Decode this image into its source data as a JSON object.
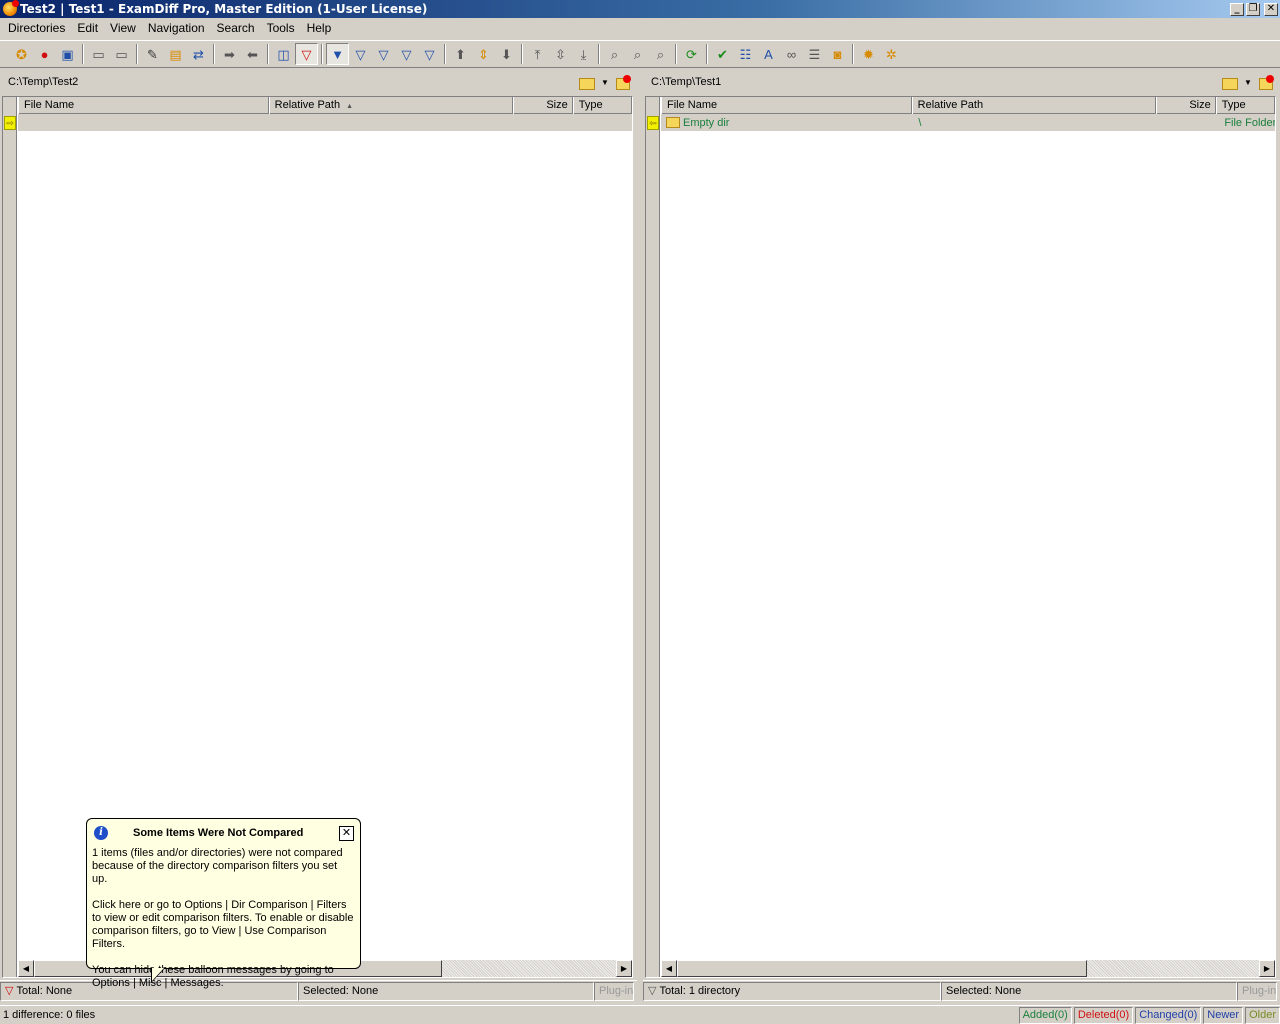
{
  "window": {
    "title": "Test2  |  Test1 - ExamDiff Pro, Master Edition (1-User License)",
    "controls": {
      "minimize": "_",
      "restore": "❐",
      "close": "✕"
    }
  },
  "menu": [
    "Directories",
    "Edit",
    "View",
    "Navigation",
    "Search",
    "Tools",
    "Help"
  ],
  "toolbar_icons": [
    "open-compare-icon",
    "cherry-icon",
    "save-icon",
    "sep",
    "panel-left-icon",
    "panel-right-icon",
    "sep",
    "edit-icon",
    "save-as-icon",
    "sync-icon",
    "sep",
    "next-difference-icon",
    "previous-difference-icon",
    "sep",
    "layout-icon",
    "filter-icon",
    "sep",
    "filter-show-all-icon",
    "filter-added-icon",
    "filter-deleted-icon",
    "filter-changed-icon",
    "filter-identical-icon",
    "sep",
    "up-icon",
    "up-down-icon",
    "down-icon",
    "sep",
    "first-icon",
    "expand-icon",
    "last-icon",
    "sep",
    "find-icon",
    "find-next-icon",
    "find-previous-icon",
    "sep",
    "refresh-icon",
    "sep",
    "check-icon",
    "comment-icon",
    "text-icon",
    "binoculars-icon",
    "list-icon",
    "camera-icon",
    "sep",
    "options-icon",
    "plugins-icon"
  ],
  "left": {
    "path": "C:\\Temp\\Test2",
    "columns": {
      "name": "File Name",
      "rel": "Relative Path",
      "size": "Size",
      "type": "Type"
    },
    "row": {
      "name": "",
      "rel": "",
      "size": "",
      "type": ""
    },
    "status": {
      "total": "Total: None",
      "selected": "Selected: None",
      "plugin": "Plug-in"
    }
  },
  "right": {
    "path": "C:\\Temp\\Test1",
    "columns": {
      "name": "File Name",
      "rel": "Relative Path",
      "size": "Size",
      "type": "Type"
    },
    "row": {
      "name": "Empty dir",
      "rel": "\\",
      "size": "",
      "type": "File Folder"
    },
    "status": {
      "total": "Total: 1 directory",
      "selected": "Selected: None",
      "plugin": "Plug-in"
    }
  },
  "balloon": {
    "title": "Some Items Were Not Compared",
    "p1": "1 items (files and/or directories) were not compared because of the directory comparison filters you set up.",
    "p2": "Click here or go to Options | Dir Comparison | Filters to view or edit comparison filters. To enable or disable comparison filters, go to View | Use Comparison Filters.",
    "p3": "You can hide these balloon messages by going to Options | Misc | Messages.",
    "close": "✕"
  },
  "statusbar": {
    "main": "1 difference: 0 files",
    "added": "Added(0)",
    "deleted": "Deleted(0)",
    "changed": "Changed(0)",
    "newer": "Newer",
    "older": "Older"
  },
  "colors": {
    "added": "#1a7f3c",
    "deleted": "#d01010",
    "changed": "#1f3fa8",
    "newer": "#1f3fa8",
    "older": "#7a8a20"
  }
}
